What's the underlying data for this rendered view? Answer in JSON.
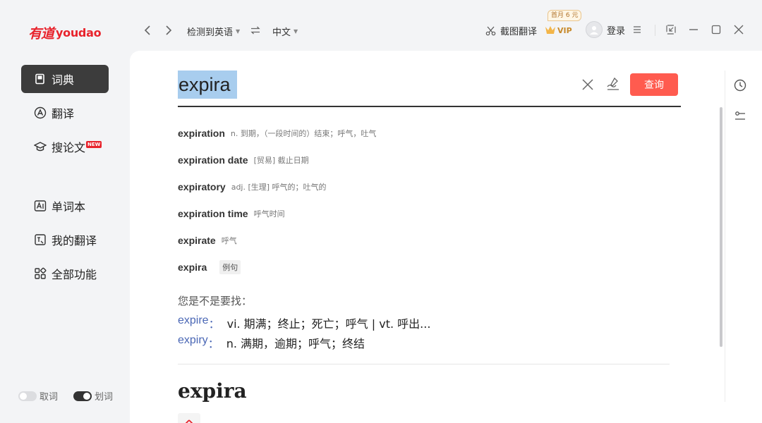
{
  "app": {
    "logo_cn": "有道",
    "logo_en": "youdao"
  },
  "sidebar": {
    "items": [
      {
        "label": "词典",
        "icon": "book-icon",
        "active": true
      },
      {
        "label": "翻译",
        "icon": "translate-icon",
        "active": false
      },
      {
        "label": "搜论文",
        "icon": "graduation-cap-icon",
        "active": false,
        "badge": "NEW"
      },
      {
        "label": "单词本",
        "icon": "wordbook-icon",
        "active": false
      },
      {
        "label": "我的翻译",
        "icon": "my-translation-icon",
        "active": false
      },
      {
        "label": "全部功能",
        "icon": "grid-icon",
        "active": false
      }
    ],
    "toggles": [
      {
        "label": "取词",
        "on": false
      },
      {
        "label": "划词",
        "on": true
      }
    ]
  },
  "topbar": {
    "source_lang": "检测到英语",
    "target_lang": "中文",
    "screenshot_translate": "截图翻译",
    "vip_promo": "首月 6 元",
    "vip_label": "VIP",
    "login": "登录"
  },
  "search": {
    "query": "expira",
    "button": "查询"
  },
  "suggestions": [
    {
      "word": "expiration",
      "def": "n. 到期，（一段时间的）结束；呼气，吐气"
    },
    {
      "word": "expiration date",
      "def": "[贸易] 截止日期"
    },
    {
      "word": "expiratory",
      "def": "adj. [生理] 呼气的；吐气的"
    },
    {
      "word": "expiration time",
      "def": "呼气时间"
    },
    {
      "word": "expirate",
      "def": "呼气"
    },
    {
      "word": "expira",
      "tag": "例句"
    }
  ],
  "did_you_mean": {
    "title": "您是不是要找：",
    "items": [
      {
        "word": "expire",
        "colon": "：",
        "def": "vi. 期满；终止；死亡；呼气 | vt. 呼出..."
      },
      {
        "word": "expiry",
        "colon": "：",
        "def": "n. 满期，逾期；呼气；终结"
      }
    ]
  },
  "result": {
    "headword": "expira"
  },
  "colors": {
    "accent": "#ff5b4f",
    "brand": "#e8232c",
    "link": "#4a67b5",
    "selection": "#a8cdee"
  }
}
